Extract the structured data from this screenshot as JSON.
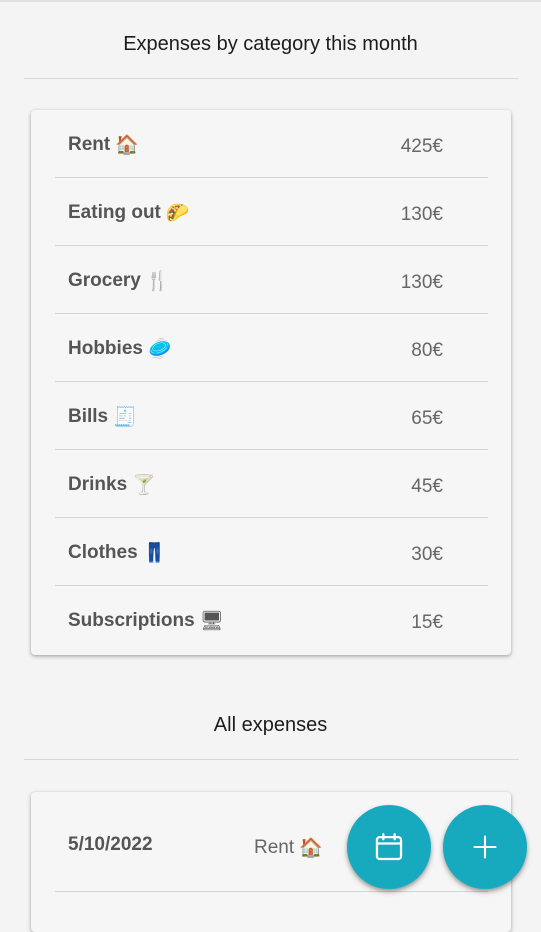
{
  "summary": {
    "title": "Expenses by category this month",
    "items": [
      {
        "label": "Rent",
        "emoji": "🏠",
        "icon": "house-icon",
        "amount": "425€"
      },
      {
        "label": "Eating out",
        "emoji": "🌮",
        "icon": "taco-icon",
        "amount": "130€"
      },
      {
        "label": "Grocery",
        "emoji": "🍴",
        "icon": "fork-knife-icon",
        "amount": "130€"
      },
      {
        "label": "Hobbies",
        "emoji": "🥏",
        "icon": "frisbee-icon",
        "amount": "80€"
      },
      {
        "label": "Bills",
        "emoji": "🧾",
        "icon": "receipt-icon",
        "amount": "65€"
      },
      {
        "label": "Drinks",
        "emoji": "🍸",
        "icon": "cocktail-icon",
        "amount": "45€"
      },
      {
        "label": "Clothes",
        "emoji": "👖",
        "icon": "jeans-icon",
        "amount": "30€"
      },
      {
        "label": "Subscriptions",
        "emoji": "🖥",
        "icon": "monitor-icon",
        "amount": "15€"
      }
    ]
  },
  "expenses": {
    "title": "All expenses",
    "items": [
      {
        "date": "5/10/2022",
        "category": "Rent",
        "emoji": "🏠",
        "icon": "house-icon"
      }
    ]
  },
  "fabs": {
    "calendar_icon": "calendar-icon",
    "add_icon": "plus-icon",
    "color": "#17aabf"
  }
}
